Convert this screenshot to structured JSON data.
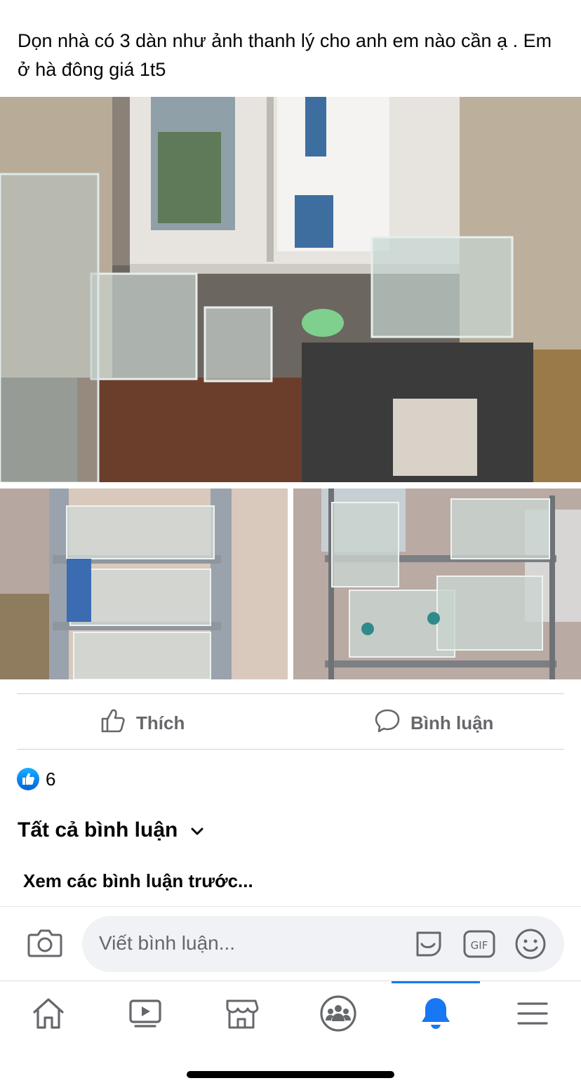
{
  "post": {
    "text": "Dọn nhà có 3 dàn như ảnh thanh lý cho anh em nào cần ạ . Em ở hà đông giá 1t5"
  },
  "photos": [
    {
      "name": "photo-main"
    },
    {
      "name": "photo-left"
    },
    {
      "name": "photo-right"
    }
  ],
  "actions": {
    "like_label": "Thích",
    "comment_label": "Bình luận"
  },
  "reactions": {
    "count": "6"
  },
  "comments": {
    "filter_label": "Tất cả bình luận",
    "previous_label": "Xem các bình luận trước..."
  },
  "composer": {
    "placeholder": "Viết bình luận..."
  },
  "icons": {
    "camera": "camera-icon",
    "sticker": "sticker-icon",
    "gif": "gif-icon",
    "emoji": "emoji-icon",
    "like": "like-icon",
    "comment": "comment-icon",
    "chevron": "chevron-down-icon"
  },
  "tabbar": {
    "tabs": [
      {
        "name": "home",
        "icon": "home-icon",
        "active": false
      },
      {
        "name": "watch",
        "icon": "video-icon",
        "active": false
      },
      {
        "name": "marketplace",
        "icon": "shop-icon",
        "active": false
      },
      {
        "name": "groups",
        "icon": "groups-icon",
        "active": false
      },
      {
        "name": "notifications",
        "icon": "bell-icon",
        "active": true
      },
      {
        "name": "menu",
        "icon": "menu-icon",
        "active": false
      }
    ]
  },
  "colors": {
    "accent": "#1877f2",
    "secondary_text": "#65676b",
    "divider": "#ced0d4",
    "input_bg": "#f0f2f5"
  }
}
